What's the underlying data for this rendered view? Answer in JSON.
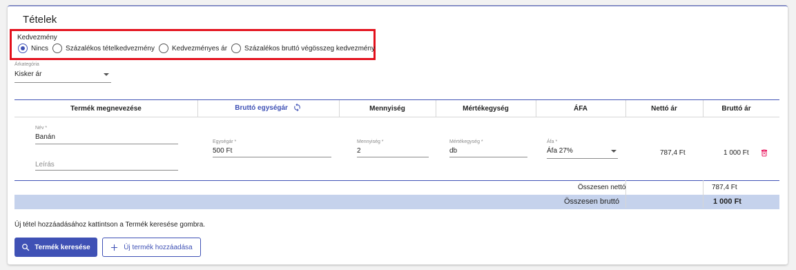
{
  "card": {
    "title": "Tételek"
  },
  "discount": {
    "label": "Kedvezmény",
    "options": [
      {
        "label": "Nincs",
        "checked": true
      },
      {
        "label": "Százalékos tételkedvezmény",
        "checked": false
      },
      {
        "label": "Kedvezményes ár",
        "checked": false
      },
      {
        "label": "Százalékos bruttó végösszeg kedvezmény",
        "checked": false
      }
    ]
  },
  "price_category": {
    "label": "Árkategória",
    "value": "Kisker ár"
  },
  "table": {
    "headers": {
      "product_name": "Termék megnevezése",
      "gross_unit_price": "Bruttó egységár",
      "quantity": "Mennyiség",
      "unit": "Mértékegység",
      "vat": "ÁFA",
      "net_price": "Nettó ár",
      "gross_price": "Bruttó ár"
    },
    "row": {
      "name_label": "Név *",
      "name_value": "Banán",
      "description_placeholder": "Leírás",
      "unit_price_label": "Egységár *",
      "unit_price_value": "500 Ft",
      "quantity_label": "Mennyiség *",
      "quantity_value": "2",
      "unit_label": "Mértékegység *",
      "unit_value": "db",
      "vat_label": "Áfa *",
      "vat_value": "Áfa 27%",
      "net_price": "787,4 Ft",
      "gross_price": "1 000 Ft"
    },
    "totals": {
      "net_label": "Összesen nettó",
      "net_value": "787,4 Ft",
      "gross_label": "Összesen bruttó",
      "gross_value": "1 000 Ft"
    }
  },
  "hint": "Új tétel hozzáadásához kattintson a Termék keresése gombra.",
  "buttons": {
    "search_product": "Termék keresése",
    "new_product": "Új termék hozzáadása"
  },
  "colors": {
    "accent": "#3f51b5",
    "highlight_border": "#e3101c",
    "totals_bg": "#c5d2ec",
    "delete_icon": "#e91e63"
  },
  "icons": {
    "refresh": "refresh-icon",
    "delete": "delete-icon",
    "search": "search-icon",
    "add": "plus-icon",
    "dropdown": "chevron-down-icon"
  }
}
